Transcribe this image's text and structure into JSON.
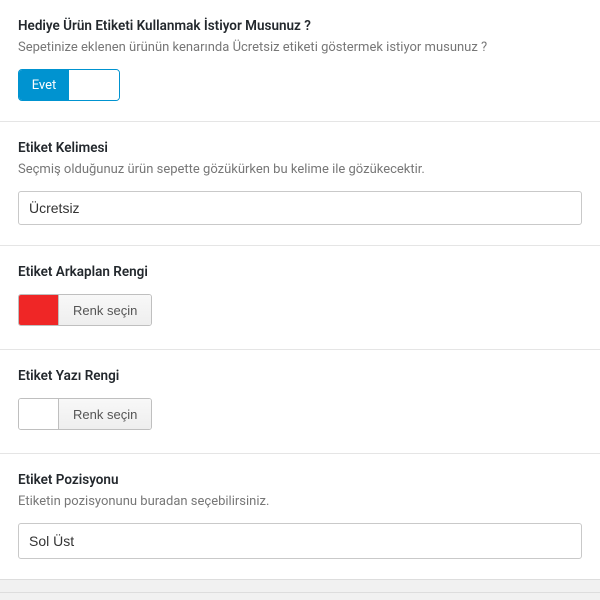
{
  "giftTag": {
    "title": "Hediye Ürün Etiketi Kullanmak İstiyor Musunuz ?",
    "desc": "Sepetinize eklenen ürünün kenarında Ücretsiz etiketi göstermek istiyor musunuz ?",
    "toggle": {
      "onLabel": "Evet",
      "state": true
    }
  },
  "labelWord": {
    "title": "Etiket Kelimesi",
    "desc": "Seçmiş olduğunuz ürün sepette gözükürken bu kelime ile gözükecektir.",
    "value": "Ücretsiz"
  },
  "bgColor": {
    "title": "Etiket Arkaplan Rengi",
    "buttonLabel": "Renk seçin",
    "swatch": "#ef2626"
  },
  "textColor": {
    "title": "Etiket Yazı Rengi",
    "buttonLabel": "Renk seçin",
    "swatch": "#ffffff"
  },
  "position": {
    "title": "Etiket Pozisyonu",
    "desc": "Etiketin pozisyonunu buradan seçebilirsiniz.",
    "value": "Sol Üst"
  }
}
